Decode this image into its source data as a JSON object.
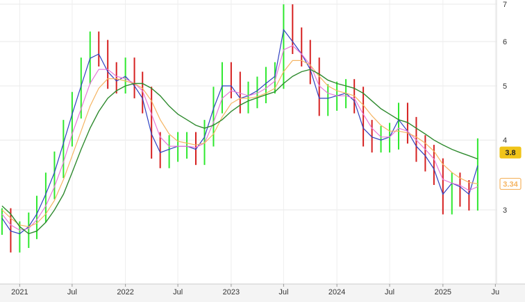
{
  "chart_data": {
    "type": "line",
    "subtype": "candlestick-with-moving-averages",
    "title": "",
    "xlabel": "",
    "ylabel": "",
    "y_scale": "log",
    "ylim": [
      2.7,
      7.0
    ],
    "xlim": [
      "2020-10-25",
      "2025-07-05"
    ],
    "grid": true,
    "y_ticks": [
      3,
      4,
      5,
      6,
      7
    ],
    "x_ticks": [
      {
        "date": "2021-01-01",
        "label": "2021"
      },
      {
        "date": "2021-07-01",
        "label": "Jul"
      },
      {
        "date": "2022-01-01",
        "label": "2022"
      },
      {
        "date": "2022-07-01",
        "label": "Jul"
      },
      {
        "date": "2023-01-01",
        "label": "2023"
      },
      {
        "date": "2023-07-01",
        "label": "Jul"
      },
      {
        "date": "2024-01-01",
        "label": "2024"
      },
      {
        "date": "2024-07-01",
        "label": "Jul"
      },
      {
        "date": "2025-01-01",
        "label": "2025"
      },
      {
        "date": "2025-07-01",
        "label": "Ju"
      }
    ],
    "price_series": {
      "name": "",
      "x": [
        "2020-11-01",
        "2020-12-01",
        "2021-01-01",
        "2021-02-01",
        "2021-03-01",
        "2021-04-01",
        "2021-05-01",
        "2021-06-01",
        "2021-07-01",
        "2021-08-01",
        "2021-09-01",
        "2021-10-01",
        "2021-11-01",
        "2021-12-01",
        "2022-01-01",
        "2022-02-01",
        "2022-03-01",
        "2022-04-01",
        "2022-05-01",
        "2022-06-01",
        "2022-07-01",
        "2022-08-01",
        "2022-09-01",
        "2022-10-01",
        "2022-11-01",
        "2022-12-01",
        "2023-01-01",
        "2023-02-01",
        "2023-03-01",
        "2023-04-01",
        "2023-05-01",
        "2023-06-01",
        "2023-07-01",
        "2023-08-01",
        "2023-09-01",
        "2023-10-01",
        "2023-11-01",
        "2023-12-01",
        "2024-01-01",
        "2024-02-01",
        "2024-03-01",
        "2024-04-01",
        "2024-05-01",
        "2024-06-01",
        "2024-07-01",
        "2024-08-01",
        "2024-09-01",
        "2024-10-01",
        "2024-11-01",
        "2024-12-01",
        "2025-01-01",
        "2025-02-01",
        "2025-03-01",
        "2025-04-01",
        "2025-05-01"
      ],
      "close": [
        2.85,
        2.65,
        2.7,
        2.8,
        3.0,
        3.3,
        3.6,
        4.1,
        4.6,
        5.3,
        5.9,
        5.7,
        5.2,
        5.1,
        5.3,
        5.0,
        4.7,
        3.9,
        3.75,
        3.85,
        3.9,
        3.9,
        3.8,
        4.1,
        4.7,
        5.2,
        5.0,
        4.7,
        4.8,
        4.9,
        5.1,
        5.2,
        6.6,
        6.0,
        5.7,
        5.3,
        4.65,
        4.75,
        4.8,
        4.85,
        4.7,
        4.1,
        4.0,
        4.0,
        4.05,
        4.4,
        4.15,
        3.85,
        3.7,
        3.5,
        3.1,
        3.3,
        3.2,
        3.15,
        3.8
      ]
    },
    "series": [
      {
        "name": "",
        "color": "#2f3fbf",
        "values": [
          2.9,
          2.75,
          2.72,
          2.8,
          2.95,
          3.2,
          3.5,
          3.95,
          4.45,
          5.0,
          5.6,
          5.7,
          5.3,
          5.1,
          5.2,
          5.0,
          4.75,
          4.1,
          3.8,
          3.85,
          3.9,
          3.9,
          3.85,
          4.05,
          4.55,
          5.0,
          5.0,
          4.75,
          4.8,
          4.9,
          5.05,
          5.2,
          6.3,
          6.0,
          5.7,
          5.35,
          4.75,
          4.75,
          4.8,
          4.85,
          4.7,
          4.2,
          4.05,
          4.0,
          4.05,
          4.35,
          4.15,
          3.9,
          3.75,
          3.55,
          3.2,
          3.35,
          3.3,
          3.2,
          3.6
        ]
      },
      {
        "name": "",
        "color": "#e878d8",
        "values": [
          2.95,
          2.82,
          2.76,
          2.78,
          2.88,
          3.05,
          3.3,
          3.65,
          4.1,
          4.55,
          5.05,
          5.35,
          5.35,
          5.2,
          5.15,
          5.05,
          4.9,
          4.45,
          4.05,
          3.9,
          3.9,
          3.9,
          3.88,
          3.95,
          4.3,
          4.75,
          4.9,
          4.85,
          4.8,
          4.85,
          4.95,
          5.1,
          5.8,
          5.9,
          5.7,
          5.45,
          5.0,
          4.85,
          4.8,
          4.8,
          4.75,
          4.45,
          4.2,
          4.05,
          4.05,
          4.2,
          4.15,
          4.0,
          3.85,
          3.7,
          3.4,
          3.35,
          3.32,
          3.25,
          3.3
        ]
      },
      {
        "name": "",
        "color": "#f5b462",
        "values": [
          3.0,
          2.9,
          2.82,
          2.8,
          2.84,
          2.95,
          3.12,
          3.4,
          3.75,
          4.15,
          4.6,
          4.95,
          5.15,
          5.15,
          5.1,
          5.05,
          4.95,
          4.7,
          4.35,
          4.1,
          3.98,
          3.95,
          3.92,
          3.95,
          4.1,
          4.4,
          4.65,
          4.75,
          4.75,
          4.78,
          4.85,
          4.95,
          5.3,
          5.55,
          5.55,
          5.45,
          5.2,
          5.0,
          4.9,
          4.85,
          4.8,
          4.62,
          4.42,
          4.25,
          4.15,
          4.15,
          4.12,
          4.05,
          3.95,
          3.82,
          3.62,
          3.5,
          3.42,
          3.36,
          3.34
        ]
      },
      {
        "name": "",
        "color": "#2e8a2e",
        "values": [
          3.05,
          2.95,
          2.8,
          2.72,
          2.75,
          2.85,
          3.0,
          3.2,
          3.5,
          3.85,
          4.2,
          4.5,
          4.75,
          4.9,
          5.0,
          5.05,
          5.05,
          4.95,
          4.8,
          4.6,
          4.45,
          4.35,
          4.25,
          4.2,
          4.25,
          4.35,
          4.5,
          4.62,
          4.7,
          4.76,
          4.82,
          4.88,
          5.05,
          5.2,
          5.3,
          5.35,
          5.25,
          5.12,
          5.05,
          5.0,
          4.95,
          4.85,
          4.7,
          4.55,
          4.45,
          4.35,
          4.3,
          4.2,
          4.1,
          4.0,
          3.92,
          3.85,
          3.8,
          3.75,
          3.7
        ]
      }
    ],
    "last_value_labels": [
      {
        "value": "3.8",
        "color": "#f0c419"
      },
      {
        "value": "3.34",
        "color": "#f5b462"
      }
    ]
  }
}
